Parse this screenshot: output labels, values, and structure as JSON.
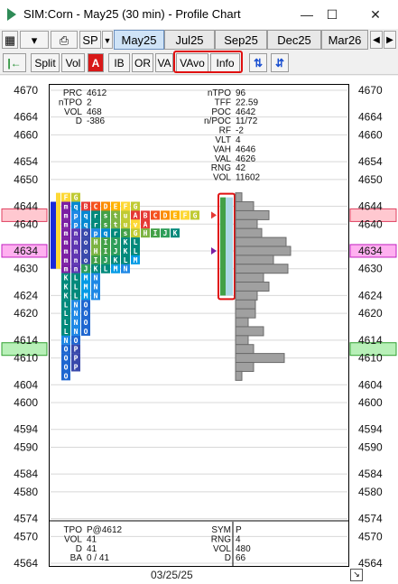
{
  "window": {
    "title": "SIM:Corn - May25 (30 min) - Profile Chart",
    "min": "—",
    "max": "☐",
    "close": "✕"
  },
  "toolbar": {
    "sp_label": "SP",
    "tabs": [
      "May25",
      "Jul25",
      "Sep25",
      "Dec25",
      "Mar26"
    ]
  },
  "toolbar2": {
    "split": "Split",
    "vol": "Vol",
    "a": "A",
    "ib": "IB",
    "or": "OR",
    "va": "VA",
    "vavo": "VAvo",
    "info": "Info"
  },
  "colors": {
    "accent_red": "#e01010",
    "poc_pink": "#ffc8d0",
    "pink2": "#ffb0f0",
    "green_hl": "#b8f0b8",
    "vol_bar": "#a0a0a0",
    "va_blue": "#add8e6"
  },
  "axis": {
    "ticks": [
      4670,
      4664,
      4660,
      4654,
      4650,
      4644,
      4640,
      4634,
      4630,
      4624,
      4620,
      4614,
      4610,
      4604,
      4600,
      4594,
      4590,
      4584,
      4580,
      4574,
      4570,
      4564
    ],
    "right_ticks": [
      4670,
      4664,
      4660,
      4654,
      4650,
      4644,
      4640,
      4634,
      4630,
      4624,
      4620,
      4614,
      4610,
      4604,
      4600,
      4594,
      4590,
      4584,
      4580,
      4574,
      4570,
      4564
    ],
    "highlights": {
      "poc": "4642",
      "mid": "4634",
      "last": "4612"
    }
  },
  "stats_left": [
    {
      "k": "PRC",
      "v": "4612"
    },
    {
      "k": "nTPO",
      "v": "2"
    },
    {
      "k": "VOL",
      "v": "468"
    },
    {
      "k": "D",
      "v": "-386"
    }
  ],
  "stats_right": [
    {
      "k": "nTPO",
      "v": "96"
    },
    {
      "k": "TFF",
      "v": "22.59"
    },
    {
      "k": "POC",
      "v": "4642"
    },
    {
      "k": "n/POC",
      "v": "11/72"
    },
    {
      "k": "RF",
      "v": "-2"
    },
    {
      "k": "VLT",
      "v": "4"
    },
    {
      "k": "VAH",
      "v": "4646"
    },
    {
      "k": "VAL",
      "v": "4626"
    },
    {
      "k": "RNG",
      "v": "42"
    },
    {
      "k": "VOL",
      "v": "11602"
    }
  ],
  "footer_left": [
    {
      "k": "TPO",
      "v": "P@4612"
    },
    {
      "k": "VOL",
      "v": "41"
    },
    {
      "k": "D",
      "v": "41"
    },
    {
      "k": "BA",
      "v": "0 / 41"
    }
  ],
  "footer_right": [
    {
      "k": "SYM",
      "v": "P"
    },
    {
      "k": "RNG",
      "v": "4"
    },
    {
      "k": "VOL",
      "v": "480"
    },
    {
      "k": "D",
      "v": "66"
    }
  ],
  "date_label": "03/25/25",
  "tpo_rows": [
    {
      "price": 4646,
      "letters": "FG"
    },
    {
      "price": 4644,
      "letters": "mqBCDEFG"
    },
    {
      "price": 4642,
      "letters": "mpqrstuABCDEFG"
    },
    {
      "price": 4640,
      "letters": "mpqrstuvA"
    },
    {
      "price": 4638,
      "letters": "mnopqrsGHIJK"
    },
    {
      "price": 4636,
      "letters": "mnoHIJKL"
    },
    {
      "price": 4634,
      "letters": "mnoHIJKL"
    },
    {
      "price": 4632,
      "letters": "mnoIJKLM"
    },
    {
      "price": 4630,
      "letters": "mnJKLMN"
    },
    {
      "price": 4628,
      "letters": "KLMN"
    },
    {
      "price": 4626,
      "letters": "KLMN"
    },
    {
      "price": 4624,
      "letters": "KLMN"
    },
    {
      "price": 4622,
      "letters": "LNO"
    },
    {
      "price": 4620,
      "letters": "LNO"
    },
    {
      "price": 4618,
      "letters": "LNO"
    },
    {
      "price": 4616,
      "letters": "LNO"
    },
    {
      "price": 4614,
      "letters": "NO"
    },
    {
      "price": 4612,
      "letters": "OP"
    },
    {
      "price": 4610,
      "letters": "OP"
    },
    {
      "price": 4608,
      "letters": "OP"
    },
    {
      "price": 4606,
      "letters": "O"
    }
  ],
  "volume_profile": [
    {
      "price": 4646,
      "v": 0.1
    },
    {
      "price": 4644,
      "v": 0.3
    },
    {
      "price": 4642,
      "v": 0.55
    },
    {
      "price": 4640,
      "v": 0.35
    },
    {
      "price": 4638,
      "v": 0.42
    },
    {
      "price": 4636,
      "v": 0.82
    },
    {
      "price": 4634,
      "v": 0.9
    },
    {
      "price": 4632,
      "v": 0.62
    },
    {
      "price": 4630,
      "v": 0.85
    },
    {
      "price": 4628,
      "v": 0.45
    },
    {
      "price": 4626,
      "v": 0.55
    },
    {
      "price": 4624,
      "v": 0.35
    },
    {
      "price": 4622,
      "v": 0.33
    },
    {
      "price": 4620,
      "v": 0.32
    },
    {
      "price": 4618,
      "v": 0.2
    },
    {
      "price": 4616,
      "v": 0.45
    },
    {
      "price": 4614,
      "v": 0.2
    },
    {
      "price": 4612,
      "v": 0.3
    },
    {
      "price": 4610,
      "v": 0.8
    },
    {
      "price": 4608,
      "v": 0.3
    },
    {
      "price": 4606,
      "v": 0.1
    }
  ]
}
